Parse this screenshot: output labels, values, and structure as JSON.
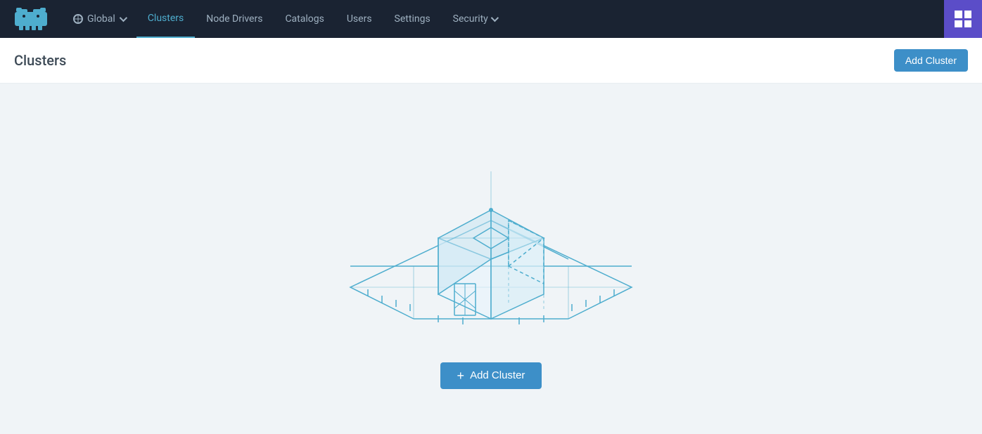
{
  "brand": {
    "alt": "Rancher Logo"
  },
  "navbar": {
    "global_label": "Global",
    "items": [
      {
        "id": "clusters",
        "label": "Clusters",
        "active": true
      },
      {
        "id": "node-drivers",
        "label": "Node Drivers",
        "active": false
      },
      {
        "id": "catalogs",
        "label": "Catalogs",
        "active": false
      },
      {
        "id": "users",
        "label": "Users",
        "active": false
      },
      {
        "id": "settings",
        "label": "Settings",
        "active": false
      },
      {
        "id": "security",
        "label": "Security",
        "active": false
      }
    ]
  },
  "page": {
    "title": "Clusters",
    "add_cluster_btn": "Add Cluster"
  },
  "empty_state": {
    "add_cluster_btn": "Add Cluster"
  },
  "colors": {
    "accent": "#3d8fc8",
    "nav_bg": "#1a2332",
    "app_switcher_bg": "#5b4dc8",
    "illustration_stroke": "#4eadce",
    "page_bg": "#f0f4f7"
  }
}
